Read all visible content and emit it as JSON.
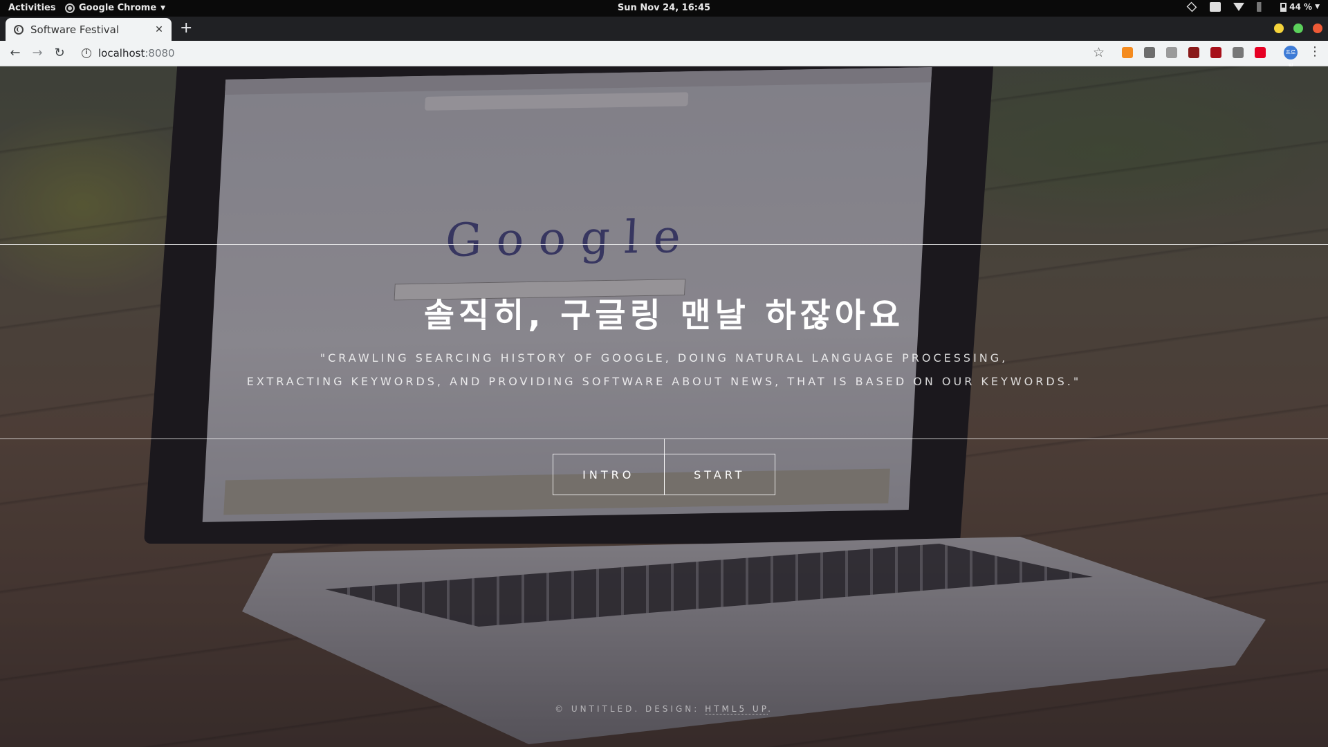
{
  "system_bar": {
    "activities": "Activities",
    "app_name": "Google Chrome",
    "clock": "Sun Nov 24, 16:45",
    "battery": "44 %"
  },
  "browser": {
    "tab_title": "Software Festival",
    "new_tab": "+",
    "url_host": "localhost",
    "url_port": ":8080",
    "window_colors": {
      "minimize": "#f5d43b",
      "maximize": "#5bd15b",
      "close": "#ee5a36"
    },
    "extensions": [
      {
        "name": "rss-ext-icon",
        "color": "#f48b1f"
      },
      {
        "name": "reader-ext-icon",
        "color": "#6d6d6d"
      },
      {
        "name": "window-ext-icon",
        "color": "#9a9a9a"
      },
      {
        "name": "red-square-ext-icon",
        "color": "#8a1a1a"
      },
      {
        "name": "ublock-ext-icon",
        "color": "#a7101a"
      },
      {
        "name": "s-ext-icon",
        "color": "#777777"
      },
      {
        "name": "pinterest-ext-icon",
        "color": "#e60023"
      }
    ],
    "profile_label": "프로필"
  },
  "hero": {
    "title": "솔직히, 구글링 맨날 하잖아요",
    "subtitle_line1": "\"CRAWLING SEARCING HISTORY OF GOOGLE, DOING NATURAL LANGUAGE PROCESSING,",
    "subtitle_line2": "EXTRACTING KEYWORDS, AND PROVIDING SOFTWARE ABOUT NEWS, THAT IS BASED ON OUR KEYWORDS.\"",
    "buttons": {
      "intro": "INTRO",
      "start": "START"
    }
  },
  "footer": {
    "copyright": "© UNTITLED. DESIGN: ",
    "link": "HTML5 UP",
    "period": "."
  }
}
